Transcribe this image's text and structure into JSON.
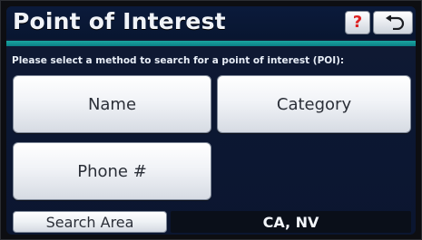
{
  "header": {
    "title": "Point of Interest",
    "help_label": "?",
    "back_icon": "back-arrow-icon"
  },
  "instruction": "Please select a method to search for a point of interest (POI):",
  "buttons": {
    "name": "Name",
    "category": "Category",
    "phone": "Phone #"
  },
  "footer": {
    "search_area_label": "Search Area",
    "area_value": "CA, NV"
  },
  "colors": {
    "title_bar_accent": "#1aa6a0",
    "help_question": "#dd2222",
    "screen_bg": "#0d1833"
  }
}
